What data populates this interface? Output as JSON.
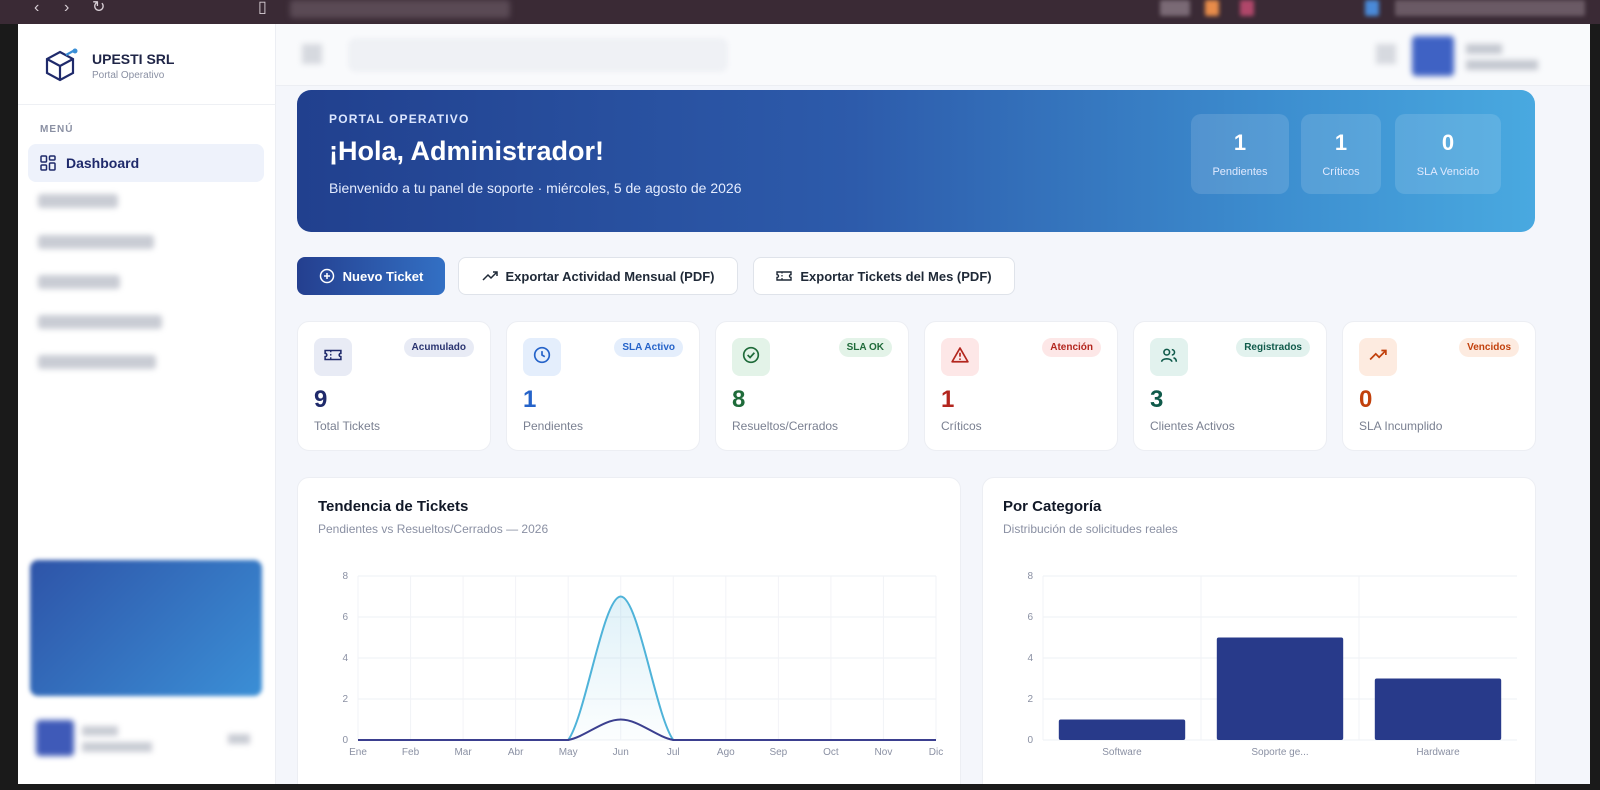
{
  "brand": {
    "name": "UPESTI SRL",
    "subtitle": "Portal Operativo"
  },
  "sidebar": {
    "menu_label": "MENÚ",
    "active_item": "Dashboard"
  },
  "hero": {
    "eyebrow": "PORTAL OPERATIVO",
    "title": "¡Hola, Administrador!",
    "subtitle": "Bienvenido a tu panel de soporte · miércoles, 5 de agosto de 2026",
    "stats": [
      {
        "value": "1",
        "label": "Pendientes"
      },
      {
        "value": "1",
        "label": "Críticos"
      },
      {
        "value": "0",
        "label": "SLA Vencido"
      }
    ]
  },
  "actions": {
    "new_ticket": "Nuevo Ticket",
    "export_activity": "Exportar Actividad Mensual (PDF)",
    "export_tickets": "Exportar Tickets del Mes (PDF)"
  },
  "cards": [
    {
      "value": "9",
      "label": "Total Tickets",
      "badge": "Acumulado",
      "color": "#1f2a6b",
      "badge_bg": "#e8ebf5",
      "badge_color": "#2a3470",
      "icon_bg": "#e8ebf5",
      "icon": "ticket-icon"
    },
    {
      "value": "1",
      "label": "Pendientes",
      "badge": "SLA Activo",
      "color": "#2563c9",
      "badge_bg": "#e4eefc",
      "badge_color": "#2563c9",
      "icon_bg": "#e4eefc",
      "icon": "clock-icon"
    },
    {
      "value": "8",
      "label": "Resueltos/Cerrados",
      "badge": "SLA OK",
      "color": "#1f6b3a",
      "badge_bg": "#e3f3e8",
      "badge_color": "#1f6b3a",
      "icon_bg": "#e3f3e8",
      "icon": "check-circle-icon"
    },
    {
      "value": "1",
      "label": "Críticos",
      "badge": "Atención",
      "color": "#b3261e",
      "badge_bg": "#fde7e7",
      "badge_color": "#b3261e",
      "icon_bg": "#fde7e7",
      "icon": "warning-icon"
    },
    {
      "value": "3",
      "label": "Clientes Activos",
      "badge": "Registrados",
      "color": "#0f5a4a",
      "badge_bg": "#e2f2ee",
      "badge_color": "#0f5a4a",
      "icon_bg": "#e2f2ee",
      "icon": "users-icon"
    },
    {
      "value": "0",
      "label": "SLA Incumplido",
      "badge": "Vencidos",
      "color": "#c2410c",
      "badge_bg": "#fdebe0",
      "badge_color": "#c2410c",
      "icon_bg": "#fdebe0",
      "icon": "trend-up-icon"
    }
  ],
  "chart_data": [
    {
      "type": "line",
      "title": "Tendencia de Tickets",
      "subtitle": "Pendientes vs Resueltos/Cerrados — 2026",
      "categories": [
        "Ene",
        "Feb",
        "Mar",
        "Abr",
        "May",
        "Jun",
        "Jul",
        "Ago",
        "Sep",
        "Oct",
        "Nov",
        "Dic"
      ],
      "series": [
        {
          "values": [
            0,
            0,
            0,
            0,
            0,
            7,
            0,
            0,
            0,
            0,
            0,
            0
          ],
          "color": "#4fb3d9"
        },
        {
          "values": [
            0,
            0,
            0,
            0,
            0,
            1,
            0,
            0,
            0,
            0,
            0,
            0
          ],
          "color": "#3b3f8f"
        }
      ],
      "ylim": [
        0,
        8
      ],
      "yticks": [
        0,
        2,
        4,
        6,
        8
      ],
      "grid": true,
      "smooth": true
    },
    {
      "type": "bar",
      "title": "Por Categoría",
      "subtitle": "Distribución de solicitudes reales",
      "categories": [
        "Software",
        "Soporte ge...",
        "Hardware"
      ],
      "values": [
        1,
        5,
        3
      ],
      "color": "#283a8a",
      "ylim": [
        0,
        8
      ],
      "yticks": [
        0,
        2,
        4,
        6,
        8
      ],
      "grid": true
    }
  ]
}
